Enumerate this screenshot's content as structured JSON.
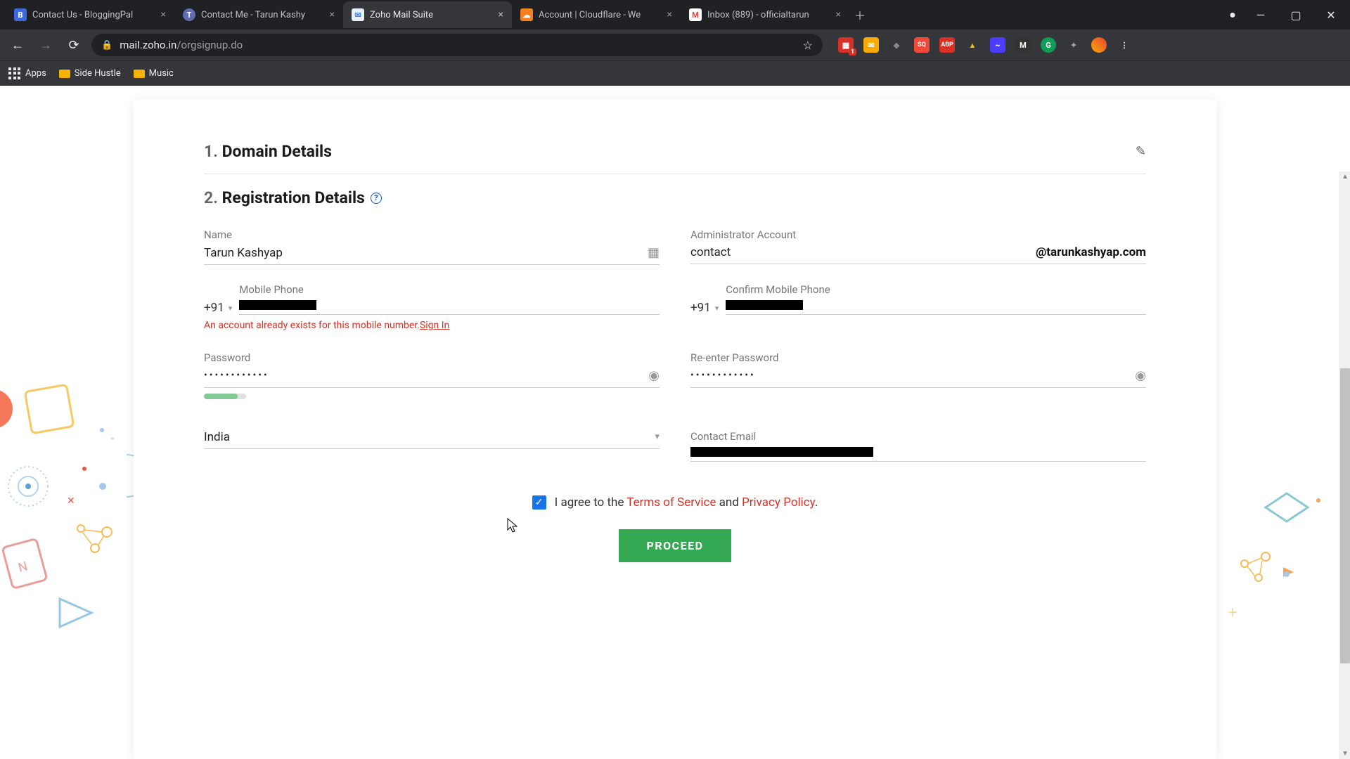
{
  "tabs": [
    {
      "title": "Contact Us - BloggingPal",
      "favicon_bg": "#3e6ae1",
      "favicon_text": "B"
    },
    {
      "title": "Contact Me - Tarun Kashy",
      "favicon_bg": "#5f6caf",
      "favicon_text": "T"
    },
    {
      "title": "Zoho Mail Suite",
      "favicon_bg": "#e8f0fc",
      "favicon_text": "✉"
    },
    {
      "title": "Account | Cloudflare - We",
      "favicon_bg": "#f48120",
      "favicon_text": "☁"
    },
    {
      "title": "Inbox (889) - officialtarun",
      "favicon_bg": "#ea4335",
      "favicon_text": "M"
    }
  ],
  "active_tab_index": 2,
  "url_host": "mail.zoho.in",
  "url_path": "/orgsignup.do",
  "bookmarks": {
    "apps": "Apps",
    "items": [
      "Side Hustle",
      "Music"
    ]
  },
  "extensions": [
    {
      "bg": "#d93025",
      "txt": "1",
      "badge": "1"
    },
    {
      "bg": "#f9ab00",
      "txt": "✉"
    },
    {
      "bg": "#888",
      "txt": "◆"
    },
    {
      "bg": "#ef4a3a",
      "txt": "SQ"
    },
    {
      "bg": "#d93025",
      "txt": "ABP"
    },
    {
      "bg": "#fbbc04",
      "txt": "▲"
    },
    {
      "bg": "#4c3cff",
      "txt": "~"
    },
    {
      "bg": "#333",
      "txt": "M"
    },
    {
      "bg": "#0f9d58",
      "txt": "G"
    },
    {
      "bg": "transparent",
      "txt": "✦",
      "color": "#aaa"
    }
  ],
  "sections": {
    "domain": {
      "num": "1.",
      "title": "Domain Details"
    },
    "reg": {
      "num": "2.",
      "title": "Registration Details"
    }
  },
  "form": {
    "name_label": "Name",
    "name_value": "Tarun Kashyap",
    "admin_label": "Administrator Account",
    "admin_value": "contact",
    "admin_domain": "@tarunkashyap.com",
    "mobile_label": "Mobile Phone",
    "mobile_code": "+91",
    "confirm_mobile_label": "Confirm Mobile Phone",
    "confirm_mobile_code": "+91",
    "mobile_error": "An account already exists for this mobile number.",
    "mobile_signin": "Sign In",
    "password_label": "Password",
    "password_masked": "••••••••••••",
    "reenter_label": "Re-enter Password",
    "reenter_masked": "••••••••••••",
    "country_value": "India",
    "contact_email_label": "Contact Email"
  },
  "agree": {
    "prefix": "I agree to the ",
    "tos": "Terms of Service",
    "mid": " and ",
    "pp": "Privacy Policy",
    "suffix": "."
  },
  "proceed": "PROCEED"
}
